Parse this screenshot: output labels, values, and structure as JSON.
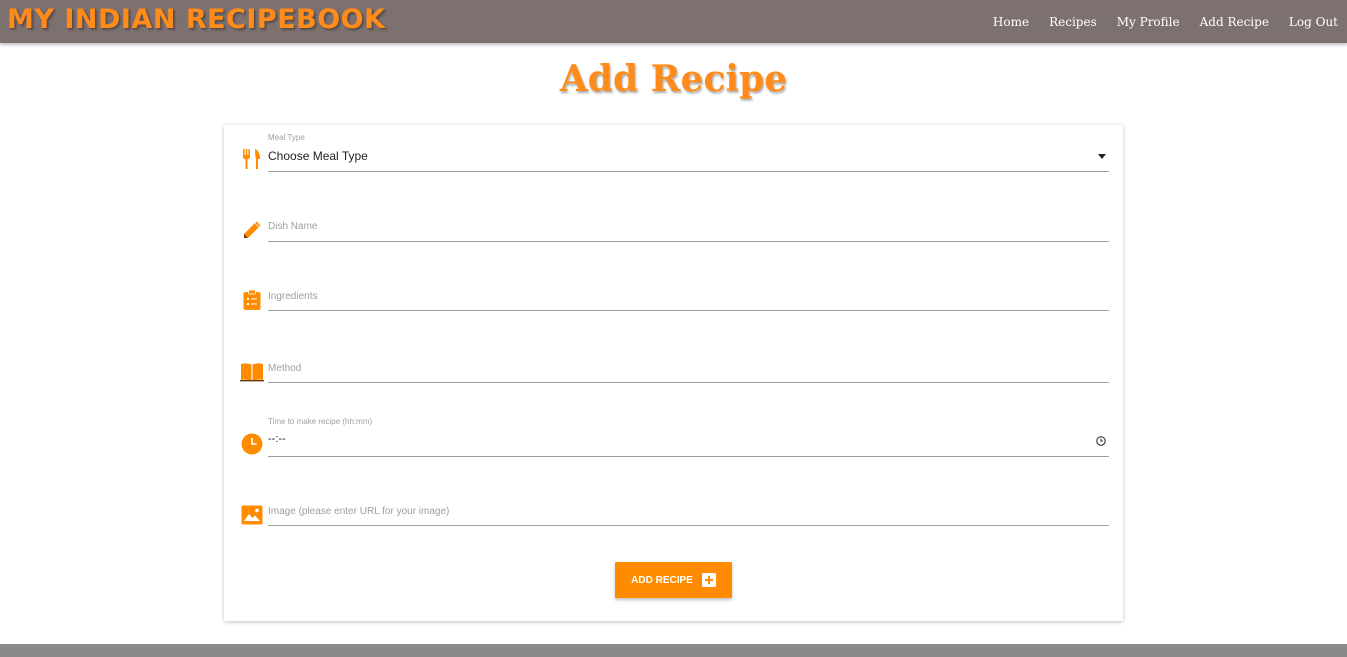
{
  "brand": {
    "title": "MY INDIAN RECIPEBOOK"
  },
  "nav": {
    "items": [
      "Home",
      "Recipes",
      "My Profile",
      "Add Recipe",
      "Log Out"
    ]
  },
  "page": {
    "title": "Add Recipe"
  },
  "form": {
    "meal_type": {
      "label": "Meal Type",
      "selected": "Choose Meal Type"
    },
    "dish_name": {
      "placeholder": "Dish Name"
    },
    "ingredients": {
      "placeholder": "Ingredients"
    },
    "method": {
      "placeholder": "Method"
    },
    "time": {
      "label": "Time to make recipe (hh:mm)",
      "value": "--:--"
    },
    "image": {
      "placeholder": "Image (please enter URL for your image)"
    },
    "submit_label": "ADD RECIPE"
  },
  "icons": {
    "meal_type": "cutlery-icon",
    "dish_name": "pencil-icon",
    "ingredients": "clipboard-list-icon",
    "method": "book-icon",
    "time": "clock-icon",
    "image": "image-icon",
    "dropdown": "caret-down-icon",
    "time_picker": "small-clock-icon",
    "submit": "plus-box-icon"
  },
  "colors": {
    "accent": "#ff8c00",
    "navbar": "#7d7170",
    "footer": "#8a8a8a"
  }
}
